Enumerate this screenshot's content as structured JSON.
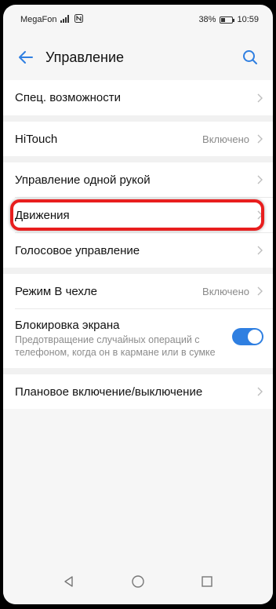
{
  "status": {
    "carrier": "MegaFon",
    "battery_percent": "38%",
    "time": "10:59",
    "battery_level": 0.38
  },
  "header": {
    "title": "Управление",
    "back_icon": "arrow-left-icon",
    "search_icon": "search-icon"
  },
  "items": {
    "accessibility": {
      "label": "Спец. возможности"
    },
    "hitouch": {
      "label": "HiTouch",
      "value": "Включено"
    },
    "one_hand": {
      "label": "Управление одной рукой"
    },
    "motions": {
      "label": "Движения"
    },
    "voice": {
      "label": "Голосовое управление"
    },
    "cover_mode": {
      "label": "Режим В чехле",
      "value": "Включено"
    },
    "screen_lock": {
      "label": "Блокировка экрана",
      "description": "Предотвращение случайных операций с телефоном, когда он в кармане или в сумке",
      "enabled": true
    },
    "scheduled_power": {
      "label": "Плановое включение/выключение"
    }
  },
  "colors": {
    "accent": "#2f7fe1",
    "highlight": "#e81e1e"
  }
}
